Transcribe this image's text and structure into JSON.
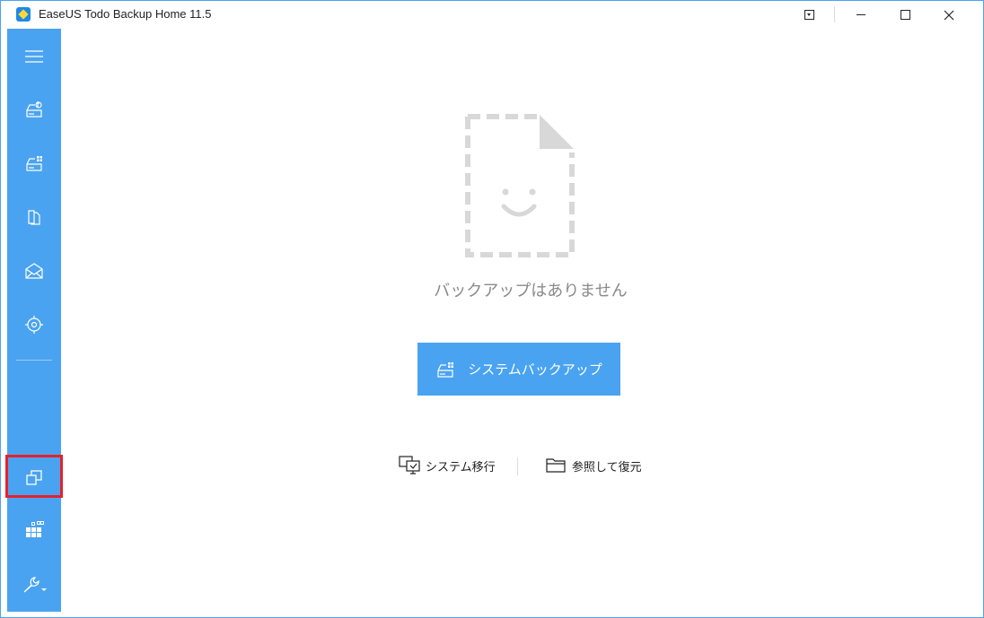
{
  "window": {
    "title": "EaseUS Todo Backup Home 11.5",
    "accent_color": "#4aa3f0",
    "highlight_color": "#e8202a"
  },
  "sidebar": {
    "items": [
      {
        "icon": "hamburger-menu-icon"
      },
      {
        "icon": "disk-backup-icon"
      },
      {
        "icon": "system-backup-icon"
      },
      {
        "icon": "file-backup-icon"
      },
      {
        "icon": "mail-backup-icon"
      },
      {
        "icon": "smart-backup-icon"
      },
      {
        "icon": "clone-icon",
        "highlighted": true
      },
      {
        "icon": "apps-icon"
      },
      {
        "icon": "tools-icon"
      }
    ]
  },
  "main": {
    "empty_text": "バックアップはありません",
    "backup_button_label": "システムバックアップ",
    "migrate_label": "システム移行",
    "browse_restore_label": "参照して復元"
  }
}
